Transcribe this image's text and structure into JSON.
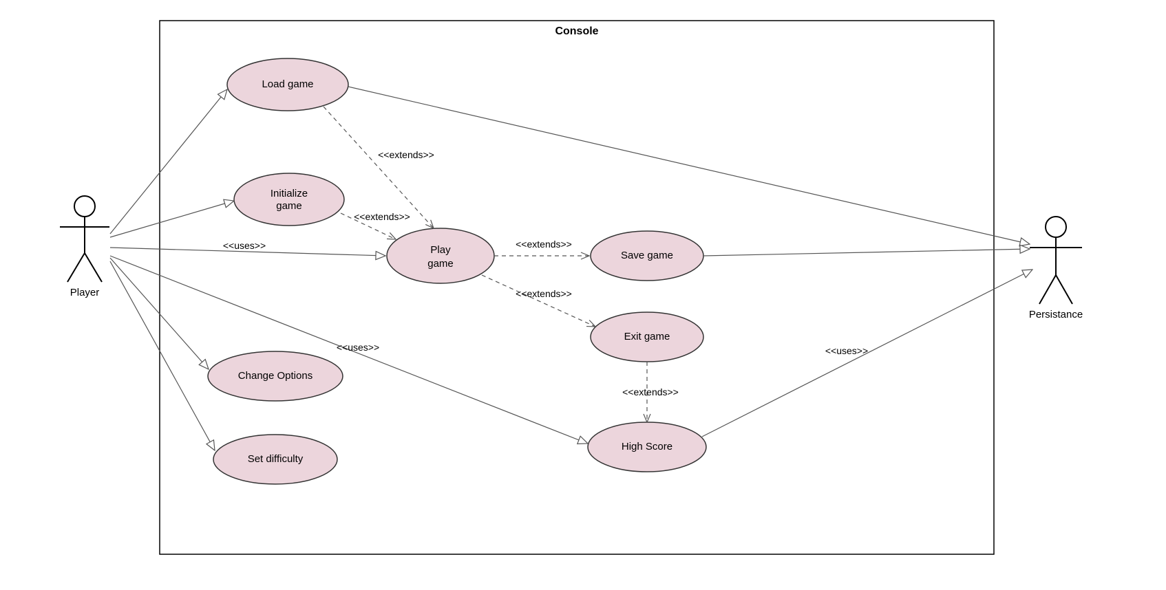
{
  "system": {
    "label": "Console"
  },
  "actors": {
    "player": {
      "label": "Player"
    },
    "persistance": {
      "label": "Persistance"
    }
  },
  "usecases": {
    "load_game": {
      "label": "Load game"
    },
    "initialize_game": {
      "line1": "Initialize",
      "line2": "game"
    },
    "play_game": {
      "line1": "Play",
      "line2": "game"
    },
    "save_game": {
      "label": "Save game"
    },
    "exit_game": {
      "label": "Exit game"
    },
    "change_options": {
      "label": "Change Options"
    },
    "set_difficulty": {
      "label": "Set difficulty"
    },
    "high_score": {
      "label": "High Score"
    }
  },
  "labels": {
    "extends": "<<extends>>",
    "uses": "<<uses>>"
  }
}
